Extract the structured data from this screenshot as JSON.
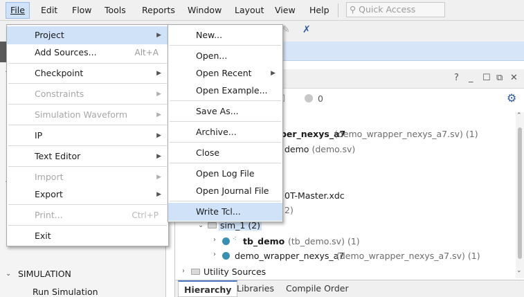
{
  "menubar": {
    "items": [
      "File",
      "Edit",
      "Flow",
      "Tools",
      "Reports",
      "Window",
      "Layout",
      "View",
      "Help"
    ],
    "quick_access_placeholder": "Quick Access"
  },
  "file_menu": {
    "project": "Project",
    "add_sources": "Add Sources...",
    "add_sources_shortcut": "Alt+A",
    "checkpoint": "Checkpoint",
    "constraints": "Constraints",
    "simulation_waveform": "Simulation Waveform",
    "ip": "IP",
    "text_editor": "Text Editor",
    "import": "Import",
    "export": "Export",
    "print": "Print...",
    "print_shortcut": "Ctrl+P",
    "exit": "Exit"
  },
  "project_submenu": {
    "new": "New...",
    "open": "Open...",
    "open_recent": "Open Recent",
    "open_example": "Open Example...",
    "save_as": "Save As...",
    "archive": "Archive...",
    "close": "Close",
    "open_log_file": "Open Log File",
    "open_journal_file": "Open Journal File",
    "write_tcl": "Write Tcl..."
  },
  "blue_band_text": "ct",
  "sources": {
    "badge_count": "0",
    "tree": {
      "row1_name": "pper_nexys_a7",
      "row1_file": "(demo_wrapper_nexys_a7.sv)",
      "row1_count": "(1)",
      "row2_name": "demo",
      "row2_file": "(demo.sv)",
      "row3_name": "0T-Master.xdc",
      "row4_count": "2)",
      "sim_1": "sim_1 (2)",
      "tb_demo": "tb_demo",
      "tb_demo_file": "(tb_demo.sv)",
      "tb_demo_count": "(1)",
      "demo_wrapper": "demo_wrapper_nexys_a7",
      "demo_wrapper_file": "(demo_wrapper_nexys_a7.sv)",
      "demo_wrapper_count": "(1)",
      "utility_sources": "Utility Sources"
    },
    "tabs": [
      "Hierarchy",
      "Libraries",
      "Compile Order"
    ]
  },
  "flow_navigator": {
    "simulation": "SIMULATION",
    "run_simulation": "Run Simulation"
  },
  "colors": {
    "menu_highlight": "#cfe2f8",
    "accent": "#4a78c2",
    "dot": "#3a8fb0"
  }
}
